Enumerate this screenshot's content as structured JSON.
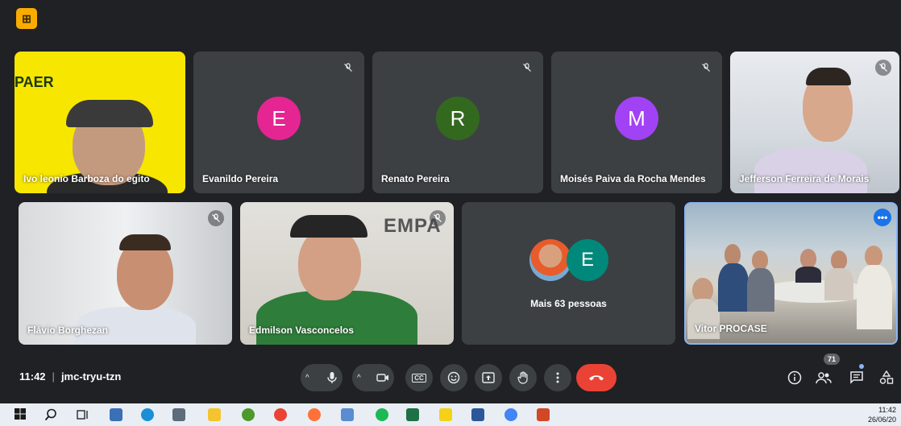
{
  "app": {
    "badge_glyph": "⊞"
  },
  "participants": [
    {
      "name": "Ivo leonio Barboza do egito",
      "type": "video",
      "logo_text": "PAER"
    },
    {
      "name": "Evanildo Pereira",
      "type": "avatar",
      "initial": "E",
      "color": "#e52592",
      "muted": true
    },
    {
      "name": "Renato Pereira",
      "type": "avatar",
      "initial": "R",
      "color": "#33691e",
      "muted": true
    },
    {
      "name": "Moisés Paiva da Rocha Mendes",
      "type": "avatar",
      "initial": "M",
      "color": "#a142f4",
      "muted": true
    },
    {
      "name": "Jefferson Ferreira de Morais",
      "type": "video",
      "muted": true
    },
    {
      "name": "Flávio Borghezan",
      "type": "video",
      "muted": true
    },
    {
      "name": "Edmilson Vasconcelos",
      "type": "video",
      "muted": true,
      "wall_text": "EMPA"
    },
    {
      "name": "Vitor PROCASE",
      "type": "video",
      "active_speaker": true
    }
  ],
  "more_tile": {
    "label": "Mais 63 pessoas",
    "avatar_initial": "E",
    "avatar_color": "#00897b"
  },
  "meeting": {
    "time": "11:42",
    "separator": "|",
    "code": "jmc-tryu-tzn"
  },
  "controls": {
    "mic": "microphone-icon",
    "camera": "camera-icon",
    "captions": "CC",
    "emoji": "emoji-icon",
    "present": "present-icon",
    "hand": "raise-hand-icon",
    "more": "more-vert-icon",
    "end": "end-call-icon",
    "caret": "^"
  },
  "side": {
    "people_count": "71"
  },
  "taskbar": {
    "time": "11:42",
    "date": "26/06/20"
  }
}
